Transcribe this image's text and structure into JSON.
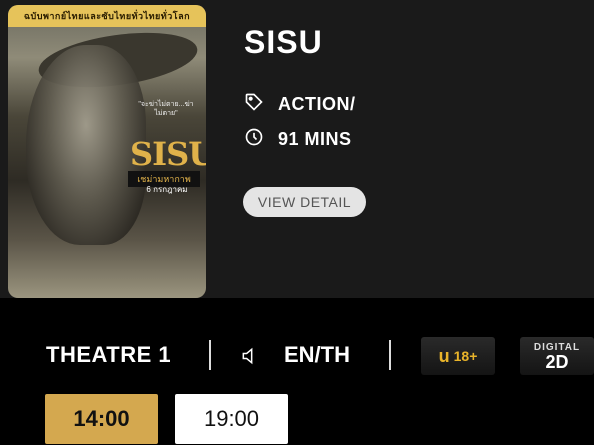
{
  "movie": {
    "title": "SISU",
    "genre": "ACTION/",
    "duration": "91 MINS",
    "view_detail_label": "VIEW DETAIL"
  },
  "poster": {
    "top_banner": "ฉบับพากย์ไทยและซับไทยทั่วไทยทั่วโลก",
    "title": "SISU",
    "subtitle": "เชม่ามหากาพ",
    "quote": "\"จะฆ่าไม่ตาย...ฆ่าไม่ตาย\"",
    "date": "6 กรกฎาคม"
  },
  "showing": {
    "theatre": "THEATRE 1",
    "language": "EN/TH",
    "rating_letter": "u",
    "rating_age": "18+",
    "format_top": "DIGITAL",
    "format_bottom": "2D"
  },
  "showtimes": [
    {
      "time": "14:00",
      "selected": true
    },
    {
      "time": "19:00",
      "selected": false
    }
  ],
  "colors": {
    "accent": "#d4a84f",
    "background": "#000000",
    "card": "#1a1a1a"
  },
  "icons": {
    "genre": "tag-icon",
    "duration": "clock-icon",
    "audio": "speaker-icon"
  }
}
